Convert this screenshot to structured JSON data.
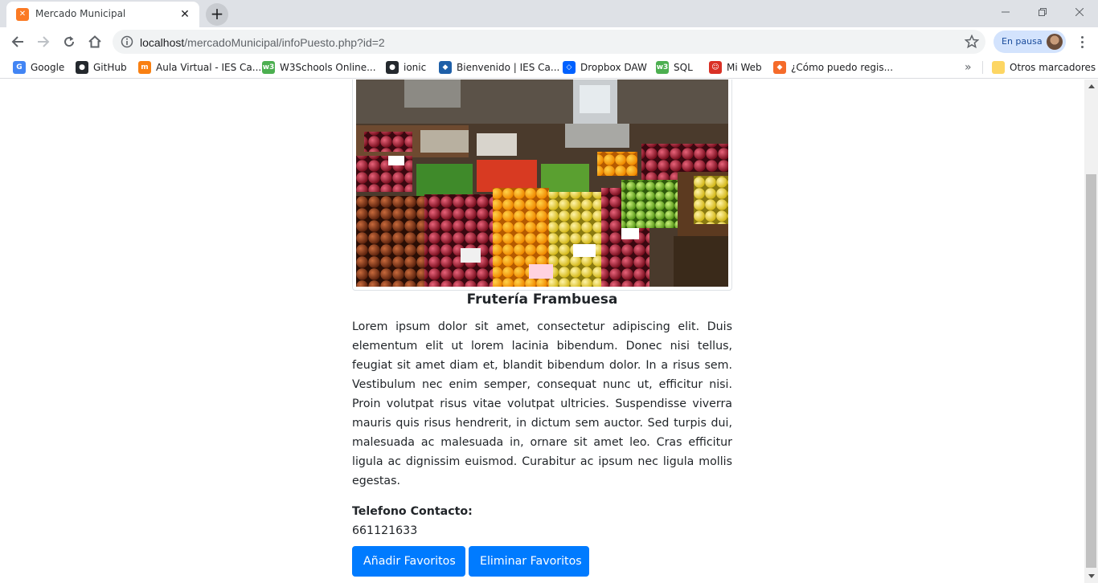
{
  "browser": {
    "tab": {
      "title": "Mercado Municipal",
      "favicon": "xampp-icon"
    },
    "url": {
      "host": "localhost",
      "path": "/mercadoMunicipal/infoPuesto.php?id=2"
    },
    "profile": {
      "label": "En pausa"
    },
    "bookmarks": [
      {
        "label": "Google",
        "icon": "google-icon",
        "color": "#4285f4"
      },
      {
        "label": "GitHub",
        "icon": "github-icon",
        "color": "#24292e"
      },
      {
        "label": "Aula Virtual - IES Ca...",
        "icon": "moodle-icon",
        "color": "#f98012"
      },
      {
        "label": "W3Schools Online...",
        "icon": "w3schools-icon",
        "color": "#4caf50"
      },
      {
        "label": "ionic",
        "icon": "github-icon",
        "color": "#24292e"
      },
      {
        "label": "Bienvenido | IES Ca...",
        "icon": "site-icon",
        "color": "#1e5fa8"
      },
      {
        "label": "Dropbox DAW",
        "icon": "dropbox-icon",
        "color": "#0061ff"
      },
      {
        "label": "SQL",
        "icon": "w3schools-icon",
        "color": "#4caf50"
      },
      {
        "label": "Mi Web",
        "icon": "web-icon",
        "color": "#d93025"
      },
      {
        "label": "¿Cómo puedo regis...",
        "icon": "site-icon",
        "color": "#f56b2a"
      }
    ],
    "other_bookmarks": "Otros marcadores"
  },
  "page": {
    "stall_name": "Frutería Frambuesa",
    "description": "Lorem ipsum dolor sit amet, consectetur adipiscing elit. Duis elementum elit ut lorem lacinia bibendum. Donec nisi tellus, feugiat sit amet diam et, blandit bibendum dolor. In a risus sem. Vestibulum nec enim semper, consequat nunc ut, efficitur nisi. Proin volutpat risus vitae volutpat ultricies. Suspendisse viverra mauris quis risus hendrerit, in dictum sem auctor. Sed turpis dui, malesuada ac malesuada in, ornare sit amet leo. Cras efficitur ligula ac dignissim euismod. Curabitur ac ipsum nec ligula mollis egestas.",
    "phone_label": "Telefono Contacto:",
    "phone": "661121633",
    "buttons": {
      "add_favorites": "Añadir Favoritos",
      "remove_favorites": "Eliminar Favoritos"
    },
    "accent_color": "#007bff"
  }
}
